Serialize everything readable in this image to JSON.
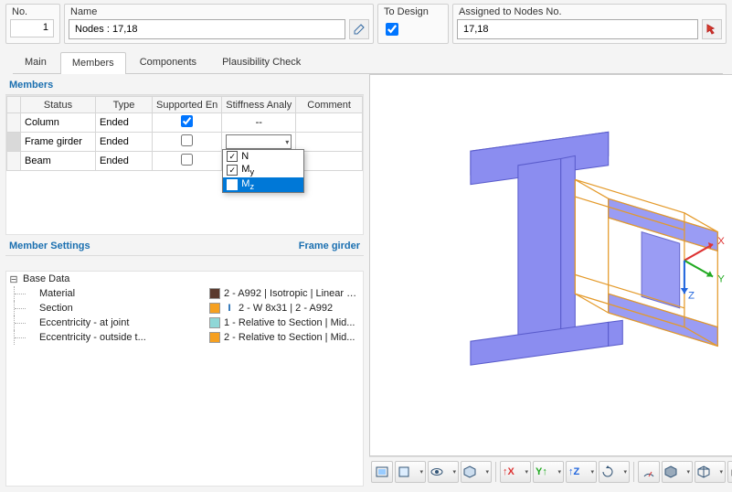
{
  "header": {
    "no_label": "No.",
    "no_value": "1",
    "name_label": "Name",
    "name_value": "Nodes : 17,18",
    "to_design_label": "To Design",
    "to_design_checked": true,
    "assigned_label": "Assigned to Nodes No.",
    "assigned_value": "17,18"
  },
  "tabs": [
    "Main",
    "Members",
    "Components",
    "Plausibility Check"
  ],
  "tabs_active_index": 1,
  "members_title": "Members",
  "members_columns": [
    "",
    "Status",
    "Type",
    "Supported En",
    "Stiffness Analy",
    "Comment"
  ],
  "members_rows": [
    {
      "status": "Column",
      "type": "Ended",
      "supported": true,
      "stiffness": "--",
      "selected": false
    },
    {
      "status": "Frame girder",
      "type": "Ended",
      "supported": false,
      "stiffness": "",
      "selected": true
    },
    {
      "status": "Beam",
      "type": "Ended",
      "supported": false,
      "stiffness": "",
      "selected": false
    }
  ],
  "stiffness_dropdown": {
    "options": [
      {
        "label": "N",
        "checked": true,
        "hover": false
      },
      {
        "label": "My",
        "checked": true,
        "hover": false
      },
      {
        "label": "Mz",
        "checked": true,
        "hover": true
      }
    ]
  },
  "settings_title": "Member Settings",
  "settings_context": "Frame girder",
  "base_data_label": "Base Data",
  "base_rows": [
    {
      "label": "Material",
      "swatch": "darkred",
      "icon": "",
      "value": "2 - A992 | Isotropic | Linear E..."
    },
    {
      "label": "Section",
      "swatch": "orange",
      "icon": "I",
      "value": "2 - W 8x31 | 2 - A992"
    },
    {
      "label": "Eccentricity - at joint",
      "swatch": "teal",
      "icon": "",
      "value": "1 - Relative to Section | Mid..."
    },
    {
      "label": "Eccentricity - outside t...",
      "swatch": "orange",
      "icon": "",
      "value": "2 - Relative to Section | Mid..."
    }
  ],
  "axes": {
    "x": "X",
    "y": "Y",
    "z": "Z"
  },
  "toolbar_icons": [
    "view-mode",
    "render-mode",
    "show-hide",
    "isometric",
    "sep",
    "view-x",
    "view-y",
    "view-z",
    "rotate",
    "sep",
    "meter",
    "solid",
    "wireframe",
    "print",
    "sep",
    "close"
  ]
}
